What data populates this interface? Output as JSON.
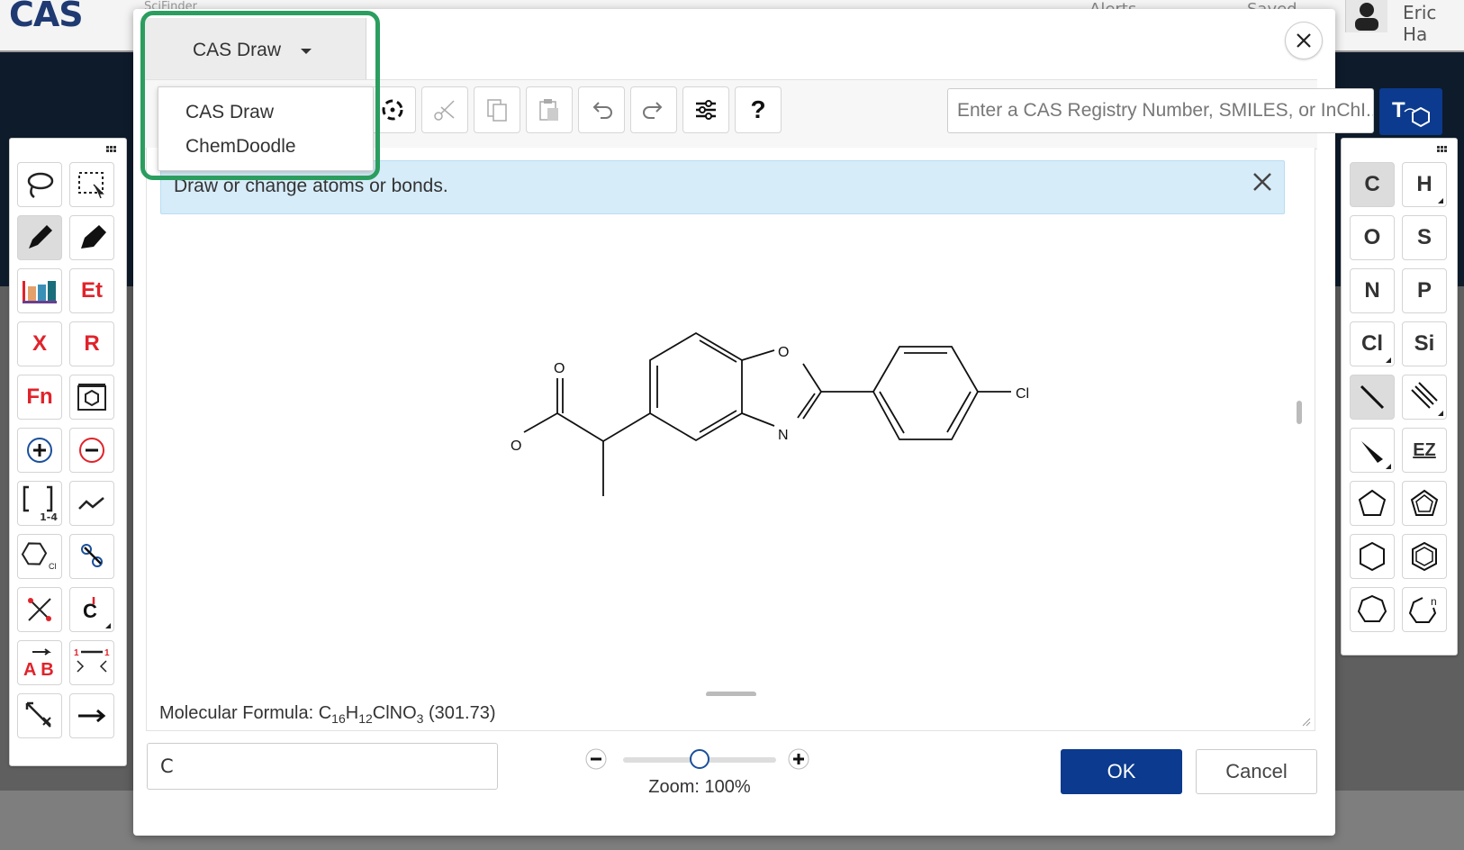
{
  "background": {
    "logo": "CAS",
    "logo_sub": "SciFinder",
    "nav_alerts": "Alerts",
    "nav_saved": "Saved",
    "user_name": "Eric Ha"
  },
  "editor": {
    "selector_label": "CAS Draw",
    "dropdown_options": [
      "CAS Draw",
      "ChemDoodle"
    ],
    "info_message": "Draw or change atoms or bonds.",
    "search_placeholder": "Enter a CAS Registry Number, SMILES, or InChI...",
    "formula_prefix": "Molecular Formula: ",
    "formula": {
      "c": "C",
      "c_n": "16",
      "h": "H",
      "h_n": "12",
      "rest": "ClNO",
      "o_n": "3",
      "mass": " (301.73)"
    },
    "atom_input_value": "C",
    "zoom_label": "Zoom: 100%",
    "zoom_percent": 100,
    "ok_label": "OK",
    "cancel_label": "Cancel",
    "help_label": "?"
  },
  "left_palette": {
    "et_label": "Et",
    "x_label": "X",
    "r_label": "R",
    "fn_label": "Fn",
    "repeat_label": "1-4",
    "ab_label": "A B"
  },
  "right_palette": {
    "atoms": [
      "C",
      "H",
      "O",
      "S",
      "N",
      "P",
      "Cl",
      "Si"
    ],
    "ez_label": "EZ",
    "ring_n_label": "n"
  },
  "molecule_labels": {
    "o_top": "O",
    "oh": "O",
    "ring_o": "O",
    "ring_n": "N",
    "cl": "Cl"
  },
  "colors": {
    "primary_button": "#0b3a8e",
    "highlight": "#2b9e5f",
    "banner": "#d6ecf9",
    "red_tool": "#e0232b"
  }
}
